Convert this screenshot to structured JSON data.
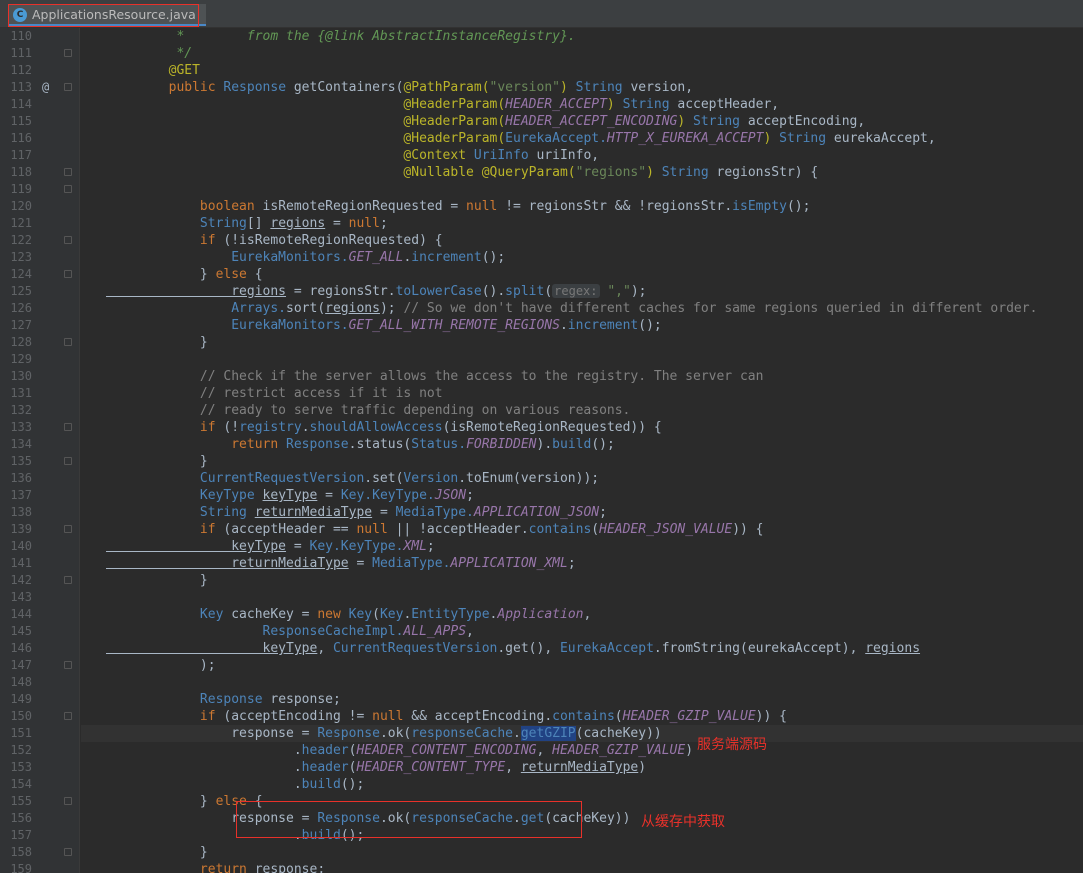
{
  "tab": {
    "filename": "ApplicationsResource.java",
    "icon": "java-class-icon"
  },
  "annotations": [
    {
      "label": "服务端源码"
    },
    {
      "label": "从缓存中获取"
    }
  ],
  "lines": [
    {
      "n": "110",
      "tokens": [
        [
          "cd",
          "         *        from the {@link AbstractInstanceRegistry}."
        ]
      ]
    },
    {
      "n": "111",
      "tokens": [
        [
          "cd",
          "         */"
        ]
      ]
    },
    {
      "n": "112",
      "tokens": [
        [
          "an",
          "        @GET"
        ]
      ]
    },
    {
      "n": "113",
      "marker": "@",
      "tokens": [
        [
          "k",
          "        public "
        ],
        [
          "fn",
          "Response "
        ],
        [
          "t",
          "getContainers("
        ],
        [
          "an",
          "@PathParam("
        ],
        [
          "s",
          "\"version\""
        ],
        [
          "an",
          ") "
        ],
        [
          "fn",
          "String "
        ],
        [
          "t",
          "version,"
        ]
      ]
    },
    {
      "n": "114",
      "tokens": [
        [
          "t",
          "                                      "
        ],
        [
          "an",
          "@HeaderParam("
        ],
        [
          "cf",
          "HEADER_ACCEPT"
        ],
        [
          "an",
          ") "
        ],
        [
          "fn",
          "String "
        ],
        [
          "t",
          "acceptHeader,"
        ]
      ]
    },
    {
      "n": "115",
      "tokens": [
        [
          "t",
          "                                      "
        ],
        [
          "an",
          "@HeaderParam("
        ],
        [
          "cf",
          "HEADER_ACCEPT_ENCODING"
        ],
        [
          "an",
          ") "
        ],
        [
          "fn",
          "String "
        ],
        [
          "t",
          "acceptEncoding,"
        ]
      ]
    },
    {
      "n": "116",
      "tokens": [
        [
          "t",
          "                                      "
        ],
        [
          "an",
          "@HeaderParam("
        ],
        [
          "fn",
          "EurekaAccept."
        ],
        [
          "cf",
          "HTTP_X_EUREKA_ACCEPT"
        ],
        [
          "an",
          ") "
        ],
        [
          "fn",
          "String "
        ],
        [
          "t",
          "eurekaAccept,"
        ]
      ]
    },
    {
      "n": "117",
      "tokens": [
        [
          "t",
          "                                      "
        ],
        [
          "an",
          "@Context "
        ],
        [
          "fn",
          "UriInfo "
        ],
        [
          "t",
          "uriInfo,"
        ]
      ]
    },
    {
      "n": "118",
      "tokens": [
        [
          "t",
          "                                      "
        ],
        [
          "an",
          "@Nullable @QueryParam("
        ],
        [
          "s",
          "\"regions\""
        ],
        [
          "an",
          ") "
        ],
        [
          "fn",
          "String "
        ],
        [
          "t",
          "regionsStr) {"
        ]
      ]
    },
    {
      "n": "119",
      "tokens": []
    },
    {
      "n": "120",
      "tokens": [
        [
          "k",
          "            boolean "
        ],
        [
          "t",
          "isRemoteRegionRequested = "
        ],
        [
          "k",
          "null "
        ],
        [
          "t",
          "!= regionsStr && !regionsStr."
        ],
        [
          "fn",
          "isEmpty"
        ],
        [
          "t",
          "();"
        ]
      ]
    },
    {
      "n": "121",
      "tokens": [
        [
          "fn",
          "            String"
        ],
        [
          "t",
          "[] "
        ],
        [
          "t u",
          "regions"
        ],
        [
          "t",
          " = "
        ],
        [
          "k",
          "null"
        ],
        [
          "t",
          ";"
        ]
      ]
    },
    {
      "n": "122",
      "tokens": [
        [
          "k",
          "            if "
        ],
        [
          "t",
          "(!isRemoteRegionRequested) {"
        ]
      ]
    },
    {
      "n": "123",
      "tokens": [
        [
          "fn",
          "                EurekaMonitors."
        ],
        [
          "cf",
          "GET_ALL"
        ],
        [
          "t",
          "."
        ],
        [
          "fn",
          "increment"
        ],
        [
          "t",
          "();"
        ]
      ]
    },
    {
      "n": "124",
      "tokens": [
        [
          "t",
          "            } "
        ],
        [
          "k",
          "else "
        ],
        [
          "t",
          "{"
        ]
      ]
    },
    {
      "n": "125",
      "tokens": [
        [
          "t u",
          "                regions"
        ],
        [
          "t",
          " = regionsStr."
        ],
        [
          "fn",
          "toLowerCase"
        ],
        [
          "t",
          "()."
        ],
        [
          "fn",
          "split"
        ],
        [
          "t",
          "("
        ],
        [
          "hint",
          "regex:"
        ],
        [
          "s",
          " \",\""
        ],
        [
          "t",
          ");"
        ]
      ]
    },
    {
      "n": "126",
      "tokens": [
        [
          "fn",
          "                Arrays."
        ],
        [
          "t",
          "sort("
        ],
        [
          "t u",
          "regions"
        ],
        [
          "t",
          "); "
        ],
        [
          "c",
          "// So we don't have different caches for same regions queried in different order."
        ]
      ]
    },
    {
      "n": "127",
      "tokens": [
        [
          "fn",
          "                EurekaMonitors."
        ],
        [
          "cf",
          "GET_ALL_WITH_REMOTE_REGIONS"
        ],
        [
          "t",
          "."
        ],
        [
          "fn",
          "increment"
        ],
        [
          "t",
          "();"
        ]
      ]
    },
    {
      "n": "128",
      "tokens": [
        [
          "t",
          "            }"
        ]
      ]
    },
    {
      "n": "129",
      "tokens": []
    },
    {
      "n": "130",
      "tokens": [
        [
          "c",
          "            // Check if the server allows the access to the registry. The server can"
        ]
      ]
    },
    {
      "n": "131",
      "tokens": [
        [
          "c",
          "            // restrict access if it is not"
        ]
      ]
    },
    {
      "n": "132",
      "tokens": [
        [
          "c",
          "            // ready to serve traffic depending on various reasons."
        ]
      ]
    },
    {
      "n": "133",
      "tokens": [
        [
          "k",
          "            if "
        ],
        [
          "t",
          "(!"
        ],
        [
          "fn",
          "registry"
        ],
        [
          "t",
          "."
        ],
        [
          "fn",
          "shouldAllowAccess"
        ],
        [
          "t",
          "(isRemoteRegionRequested)) {"
        ]
      ]
    },
    {
      "n": "134",
      "tokens": [
        [
          "k",
          "                return "
        ],
        [
          "fn",
          "Response"
        ],
        [
          "t",
          ".status("
        ],
        [
          "fn",
          "Status."
        ],
        [
          "cf",
          "FORBIDDEN"
        ],
        [
          "t",
          ")."
        ],
        [
          "fn",
          "build"
        ],
        [
          "t",
          "();"
        ]
      ]
    },
    {
      "n": "135",
      "tokens": [
        [
          "t",
          "            }"
        ]
      ]
    },
    {
      "n": "136",
      "tokens": [
        [
          "fn",
          "            CurrentRequestVersion"
        ],
        [
          "t",
          ".set("
        ],
        [
          "fn",
          "Version"
        ],
        [
          "t",
          ".toEnum(version));"
        ]
      ]
    },
    {
      "n": "137",
      "tokens": [
        [
          "fn",
          "            KeyType "
        ],
        [
          "t u",
          "keyType"
        ],
        [
          "t",
          " = "
        ],
        [
          "fn",
          "Key.KeyType."
        ],
        [
          "cf",
          "JSON"
        ],
        [
          "t",
          ";"
        ]
      ]
    },
    {
      "n": "138",
      "tokens": [
        [
          "fn",
          "            String "
        ],
        [
          "t u",
          "returnMediaType"
        ],
        [
          "t",
          " = "
        ],
        [
          "fn",
          "MediaType."
        ],
        [
          "cf",
          "APPLICATION_JSON"
        ],
        [
          "t",
          ";"
        ]
      ]
    },
    {
      "n": "139",
      "tokens": [
        [
          "k",
          "            if "
        ],
        [
          "t",
          "(acceptHeader == "
        ],
        [
          "k",
          "null "
        ],
        [
          "t",
          "|| !acceptHeader."
        ],
        [
          "fn",
          "contains"
        ],
        [
          "t",
          "("
        ],
        [
          "cf",
          "HEADER_JSON_VALUE"
        ],
        [
          "t",
          ")) {"
        ]
      ]
    },
    {
      "n": "140",
      "tokens": [
        [
          "t u",
          "                keyType"
        ],
        [
          "t",
          " = "
        ],
        [
          "fn",
          "Key.KeyType."
        ],
        [
          "cf",
          "XML"
        ],
        [
          "t",
          ";"
        ]
      ]
    },
    {
      "n": "141",
      "tokens": [
        [
          "t u",
          "                returnMediaType"
        ],
        [
          "t",
          " = "
        ],
        [
          "fn",
          "MediaType."
        ],
        [
          "cf",
          "APPLICATION_XML"
        ],
        [
          "t",
          ";"
        ]
      ]
    },
    {
      "n": "142",
      "tokens": [
        [
          "t",
          "            }"
        ]
      ]
    },
    {
      "n": "143",
      "tokens": []
    },
    {
      "n": "144",
      "tokens": [
        [
          "fn",
          "            Key "
        ],
        [
          "t",
          "cacheKey = "
        ],
        [
          "k",
          "new "
        ],
        [
          "fn",
          "Key"
        ],
        [
          "t",
          "("
        ],
        [
          "fn",
          "Key"
        ],
        [
          "t",
          "."
        ],
        [
          "fn",
          "EntityType"
        ],
        [
          "t",
          "."
        ],
        [
          "cf",
          "Application"
        ],
        [
          "t",
          ","
        ]
      ]
    },
    {
      "n": "145",
      "tokens": [
        [
          "fn",
          "                    ResponseCacheImpl."
        ],
        [
          "cf",
          "ALL_APPS"
        ],
        [
          "t",
          ","
        ]
      ]
    },
    {
      "n": "146",
      "tokens": [
        [
          "t u",
          "                    keyType"
        ],
        [
          "t",
          ", "
        ],
        [
          "fn",
          "CurrentRequestVersion"
        ],
        [
          "t",
          ".get(), "
        ],
        [
          "fn",
          "EurekaAccept"
        ],
        [
          "t",
          ".fromString(eurekaAccept), "
        ],
        [
          "t u",
          "regions"
        ]
      ]
    },
    {
      "n": "147",
      "tokens": [
        [
          "t",
          "            );"
        ]
      ]
    },
    {
      "n": "148",
      "tokens": []
    },
    {
      "n": "149",
      "tokens": [
        [
          "fn",
          "            Response "
        ],
        [
          "t",
          "response;"
        ]
      ]
    },
    {
      "n": "150",
      "tokens": [
        [
          "k",
          "            if "
        ],
        [
          "t",
          "(acceptEncoding != "
        ],
        [
          "k",
          "null "
        ],
        [
          "t",
          "&& acceptEncoding."
        ],
        [
          "fn",
          "contains"
        ],
        [
          "t",
          "("
        ],
        [
          "cf",
          "HEADER_GZIP_VALUE"
        ],
        [
          "t",
          ")) {"
        ]
      ]
    },
    {
      "n": "151",
      "caret": true,
      "tokens": [
        [
          "t",
          "                response = "
        ],
        [
          "fn",
          "Response"
        ],
        [
          "t",
          ".ok("
        ],
        [
          "fn",
          "responseCache"
        ],
        [
          "t",
          "."
        ],
        [
          "fn sel",
          "getGZIP"
        ],
        [
          "t",
          "(cacheKey))"
        ]
      ]
    },
    {
      "n": "152",
      "tokens": [
        [
          "t",
          "                        ."
        ],
        [
          "fn",
          "header"
        ],
        [
          "t",
          "("
        ],
        [
          "cf",
          "HEADER_CONTENT_ENCODING"
        ],
        [
          "t",
          ", "
        ],
        [
          "cf",
          "HEADER_GZIP_VALUE"
        ],
        [
          "t",
          ")"
        ]
      ]
    },
    {
      "n": "153",
      "tokens": [
        [
          "t",
          "                        ."
        ],
        [
          "fn",
          "header"
        ],
        [
          "t",
          "("
        ],
        [
          "cf",
          "HEADER_CONTENT_TYPE"
        ],
        [
          "t",
          ", "
        ],
        [
          "t u",
          "returnMediaType"
        ],
        [
          "t",
          ")"
        ]
      ]
    },
    {
      "n": "154",
      "tokens": [
        [
          "t",
          "                        ."
        ],
        [
          "fn",
          "build"
        ],
        [
          "t",
          "();"
        ]
      ]
    },
    {
      "n": "155",
      "tokens": [
        [
          "t",
          "            } "
        ],
        [
          "k",
          "else "
        ],
        [
          "t",
          "{"
        ]
      ]
    },
    {
      "n": "156",
      "tokens": [
        [
          "t",
          "                response = "
        ],
        [
          "fn",
          "Response"
        ],
        [
          "t",
          ".ok("
        ],
        [
          "fn",
          "responseCache"
        ],
        [
          "t",
          "."
        ],
        [
          "fn",
          "get"
        ],
        [
          "t",
          "(cacheKey))"
        ]
      ]
    },
    {
      "n": "157",
      "tokens": [
        [
          "t",
          "                        ."
        ],
        [
          "fn",
          "build"
        ],
        [
          "t",
          "();"
        ]
      ]
    },
    {
      "n": "158",
      "tokens": [
        [
          "t",
          "            }"
        ]
      ]
    },
    {
      "n": "159",
      "tokens": [
        [
          "k",
          "            return "
        ],
        [
          "t",
          "response;"
        ]
      ]
    }
  ]
}
